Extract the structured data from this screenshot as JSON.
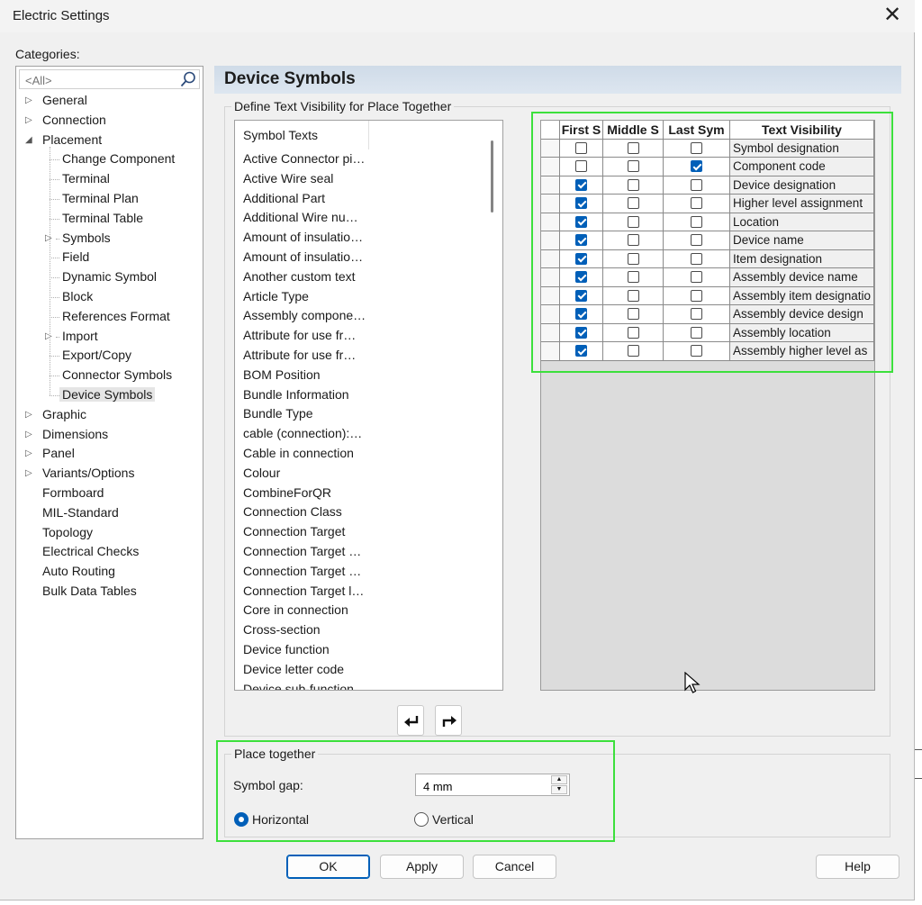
{
  "window": {
    "title": "Electric Settings",
    "close_glyph": "✕"
  },
  "categories": {
    "label": "Categories:",
    "search_placeholder": "<All>",
    "tree": [
      {
        "label": "General",
        "level": 0,
        "expander": "collapsed"
      },
      {
        "label": "Connection",
        "level": 0,
        "expander": "collapsed"
      },
      {
        "label": "Placement",
        "level": 0,
        "expander": "expanded"
      },
      {
        "label": "Change Component",
        "level": 1,
        "expander": "none"
      },
      {
        "label": "Terminal",
        "level": 1,
        "expander": "none"
      },
      {
        "label": "Terminal Plan",
        "level": 1,
        "expander": "none"
      },
      {
        "label": "Terminal Table",
        "level": 1,
        "expander": "none"
      },
      {
        "label": "Symbols",
        "level": 1,
        "expander": "collapsed"
      },
      {
        "label": "Field",
        "level": 1,
        "expander": "none"
      },
      {
        "label": "Dynamic Symbol",
        "level": 1,
        "expander": "none"
      },
      {
        "label": "Block",
        "level": 1,
        "expander": "none"
      },
      {
        "label": "References Format",
        "level": 1,
        "expander": "none"
      },
      {
        "label": "Import",
        "level": 1,
        "expander": "collapsed"
      },
      {
        "label": "Export/Copy",
        "level": 1,
        "expander": "none"
      },
      {
        "label": "Connector Symbols",
        "level": 1,
        "expander": "none"
      },
      {
        "label": "Device Symbols",
        "level": 1,
        "expander": "none",
        "selected": true
      },
      {
        "label": "Graphic",
        "level": 0,
        "expander": "collapsed"
      },
      {
        "label": "Dimensions",
        "level": 0,
        "expander": "collapsed"
      },
      {
        "label": "Panel",
        "level": 0,
        "expander": "collapsed"
      },
      {
        "label": "Variants/Options",
        "level": 0,
        "expander": "collapsed"
      },
      {
        "label": "Formboard",
        "level": 0,
        "expander": "none"
      },
      {
        "label": "MIL-Standard",
        "level": 0,
        "expander": "none"
      },
      {
        "label": "Topology",
        "level": 0,
        "expander": "none"
      },
      {
        "label": "Electrical Checks",
        "level": 0,
        "expander": "none"
      },
      {
        "label": "Auto Routing",
        "level": 0,
        "expander": "none"
      },
      {
        "label": "Bulk Data Tables",
        "level": 0,
        "expander": "none"
      }
    ]
  },
  "page": {
    "title": "Device Symbols",
    "define_group_label": "Define Text Visibility for Place Together",
    "symbol_texts": {
      "header": "Symbol Texts",
      "items": [
        "Active Connector pi…",
        "Active Wire seal",
        "Additional Part",
        "Additional Wire nu…",
        "Amount of insulatio…",
        "Amount of insulatio…",
        "Another custom text",
        "Article Type",
        "Assembly compone…",
        "Attribute for use fr…",
        "Attribute for use fr…",
        "BOM Position",
        "Bundle Information",
        "Bundle Type",
        "cable (connection):…",
        "Cable in connection",
        "Colour",
        "CombineForQR",
        "Connection Class",
        "Connection Target",
        "Connection Target …",
        "Connection Target …",
        "Connection Target l…",
        "Core in connection",
        "Cross-section",
        "Device function",
        "Device letter code",
        "Device sub-function"
      ]
    },
    "arrows": {
      "left": "move-left",
      "right": "move-right"
    },
    "visibility_grid": {
      "columns": [
        "First S",
        "Middle S",
        "Last Sym",
        "Text Visibility"
      ],
      "rows": [
        {
          "first": false,
          "middle": false,
          "last": false,
          "text": "Symbol designation"
        },
        {
          "first": false,
          "middle": false,
          "last": true,
          "text": "Component code"
        },
        {
          "first": true,
          "middle": false,
          "last": false,
          "text": "Device designation"
        },
        {
          "first": true,
          "middle": false,
          "last": false,
          "text": "Higher level assignment"
        },
        {
          "first": true,
          "middle": false,
          "last": false,
          "text": "Location"
        },
        {
          "first": true,
          "middle": false,
          "last": false,
          "text": "Device name"
        },
        {
          "first": true,
          "middle": false,
          "last": false,
          "text": "Item designation"
        },
        {
          "first": true,
          "middle": false,
          "last": false,
          "text": "Assembly device name"
        },
        {
          "first": true,
          "middle": false,
          "last": false,
          "text": "Assembly item designatio"
        },
        {
          "first": true,
          "middle": false,
          "last": false,
          "text": "Assembly device design"
        },
        {
          "first": true,
          "middle": false,
          "last": false,
          "text": "Assembly location"
        },
        {
          "first": true,
          "middle": false,
          "last": false,
          "text": "Assembly higher level as"
        }
      ]
    },
    "place_together": {
      "label": "Place together",
      "symbol_gap_label": "Symbol gap:",
      "symbol_gap_value": "4 mm",
      "orientation": [
        {
          "label": "Horizontal",
          "selected": true
        },
        {
          "label": "Vertical",
          "selected": false
        }
      ]
    }
  },
  "buttons": {
    "ok": "OK",
    "apply": "Apply",
    "cancel": "Cancel",
    "help": "Help"
  },
  "colors": {
    "accent": "#005fb8",
    "highlight": "#3ce03c",
    "header_bg": "#d6e1ec"
  }
}
